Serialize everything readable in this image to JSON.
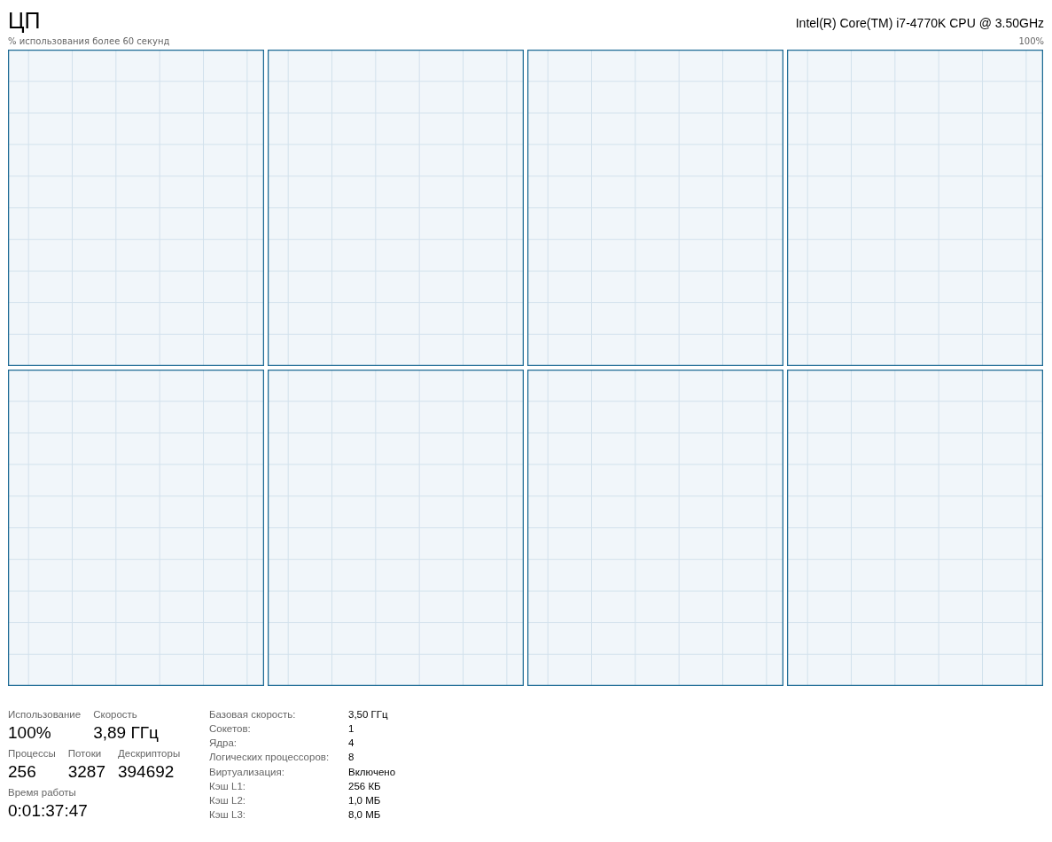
{
  "title": "ЦП",
  "cpu_name": "Intel(R) Core(TM) i7-4770K CPU @ 3.50GHz",
  "graph_caption": "% использования более 60 секунд",
  "graph_max": "100%",
  "graphs": [
    {
      "kind": "cpu-usage"
    },
    {
      "kind": "cpu-usage"
    },
    {
      "kind": "cpu-usage"
    },
    {
      "kind": "cpu-usage"
    },
    {
      "kind": "cpu-usage"
    },
    {
      "kind": "cpu-usage"
    },
    {
      "kind": "cpu-usage"
    },
    {
      "kind": "cpu-usage"
    }
  ],
  "stat_rows": [
    [
      {
        "label": "Использование",
        "value": "100%"
      },
      {
        "label": "Скорость",
        "value": "3,89 ГГц"
      }
    ],
    [
      {
        "label": "Процессы",
        "value": "256"
      },
      {
        "label": "Потоки",
        "value": "3287"
      },
      {
        "label": "Дескрипторы",
        "value": "394692"
      }
    ],
    [
      {
        "label": "Время работы",
        "value": "0:01:37:47"
      }
    ]
  ],
  "details": [
    {
      "label": "Базовая скорость:",
      "value": "3,50 ГГц"
    },
    {
      "label": "Сокетов:",
      "value": "1"
    },
    {
      "label": "Ядра:",
      "value": "4"
    },
    {
      "label": "Логических процессоров:",
      "value": "8"
    },
    {
      "label": "Виртуализация:",
      "value": "Включено"
    },
    {
      "label": "Кэш L1:",
      "value": "256 КБ"
    },
    {
      "label": "Кэш L2:",
      "value": "1,0 МБ"
    },
    {
      "label": "Кэш L3:",
      "value": "8,0 МБ"
    }
  ]
}
